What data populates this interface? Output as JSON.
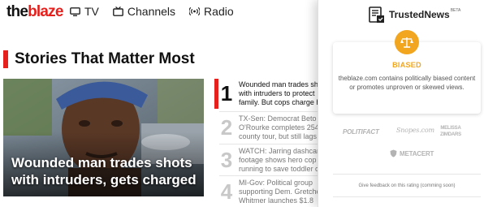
{
  "site": {
    "logo_the": "the",
    "logo_blaze": "blaze",
    "nav": [
      {
        "label": "TV",
        "icon": "tv-icon"
      },
      {
        "label": "Channels",
        "icon": "channels-icon"
      },
      {
        "label": "Radio",
        "icon": "radio-icon"
      }
    ]
  },
  "section": {
    "title": "Stories That Matter Most"
  },
  "hero": {
    "caption": "Wounded man trades shots with intruders, gets charged"
  },
  "stories": [
    {
      "num": "1",
      "lines": [
        "Wounded man trades sho",
        "with intruders to protect",
        "family. But cops charge h"
      ]
    },
    {
      "num": "2",
      "lines": [
        "TX-Sen: Democrat Beto",
        "O'Rourke completes 254",
        "county tour, but still lags"
      ]
    },
    {
      "num": "3",
      "lines": [
        "WATCH: Jarring dashcan",
        "footage shows hero cop",
        "running to save toddler o"
      ]
    },
    {
      "num": "4",
      "lines": [
        "MI-Gov: Political group",
        "supporting Dem. Gretche",
        "Whitmer launches $1.8"
      ]
    }
  ],
  "popup": {
    "brand": "TrustedNews",
    "beta": "BETA",
    "rating": "BIASED",
    "description": "theblaze.com contains politically biased content or promotes unproven or skewed views.",
    "partners": {
      "politifact": "POLITIFACT",
      "snopes": "Snopes.com",
      "melissa_1": "MELISSA",
      "melissa_2": "ZIMDARS",
      "metacert": "METACERT"
    },
    "feedback": "Give feedback on this rating (comming soon)"
  },
  "colors": {
    "brand_red": "#e5201d",
    "biased_orange": "#f2a51f"
  }
}
